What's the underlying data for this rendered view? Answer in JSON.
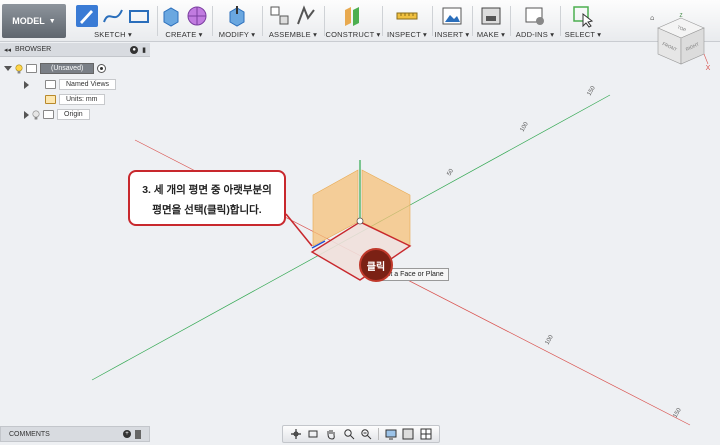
{
  "toolbar": {
    "model_label": "MODEL",
    "groups": [
      {
        "label": "SKETCH ▾"
      },
      {
        "label": "CREATE ▾"
      },
      {
        "label": "MODIFY ▾"
      },
      {
        "label": "ASSEMBLE ▾"
      },
      {
        "label": "CONSTRUCT ▾"
      },
      {
        "label": "INSPECT ▾"
      },
      {
        "label": "INSERT ▾"
      },
      {
        "label": "MAKE ▾"
      },
      {
        "label": "ADD-INS ▾"
      },
      {
        "label": "SELECT ▾"
      }
    ]
  },
  "browser": {
    "title": "BROWSER",
    "root": "(Unsaved)",
    "items": [
      {
        "label": "Named Views"
      },
      {
        "label": "Units: mm"
      },
      {
        "label": "Origin"
      }
    ]
  },
  "comments": {
    "title": "COMMENTS"
  },
  "viewport": {
    "callout_line1": "3. 세 개의 평면 중 아랫부분의",
    "callout_line2": "평면을 선택(클릭)합니다.",
    "click_badge": "클릭",
    "tooltip": "ect a Face or Plane",
    "axis_labels": [
      "150",
      "100",
      "50",
      "100",
      "150"
    ]
  },
  "viewcube": {
    "faces": [
      "TOP",
      "FRONT",
      "RIGHT"
    ],
    "axis_x": "X",
    "axis_z": "Z"
  },
  "colors": {
    "accent_red": "#c8282d",
    "plane_orange": "#f5c27a",
    "axis_red": "#d9534f",
    "axis_green": "#34a853"
  }
}
